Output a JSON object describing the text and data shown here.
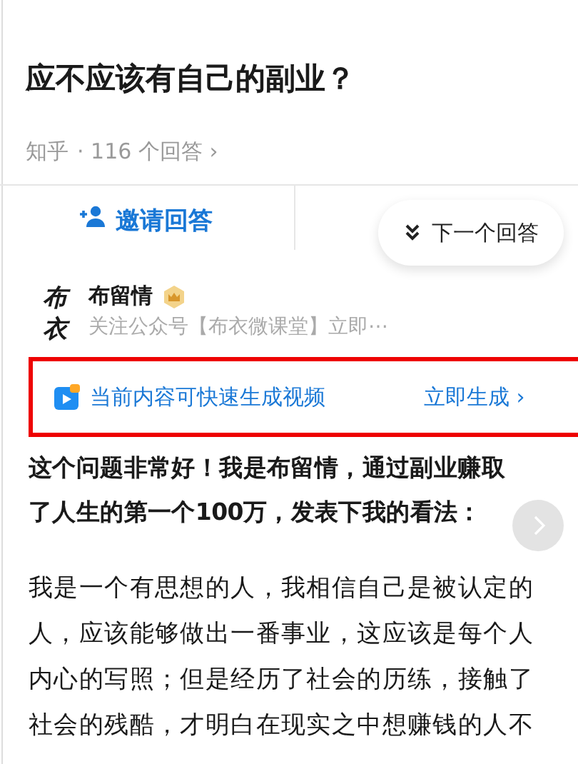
{
  "question": {
    "title": "应不应该有自己的副业？",
    "source": "知乎",
    "answer_count": "· 116 个回答",
    "chevron": "›"
  },
  "actions": {
    "invite": "邀请回答",
    "next": "下一个回答"
  },
  "author": {
    "name": "布留情",
    "logo": "布衣",
    "bio": "关注公众号【布衣微课堂】立即⋯"
  },
  "promo": {
    "text": "当前内容可快速生成视频",
    "action": "立即生成",
    "chevron": "›"
  },
  "answer": {
    "lead": "这个问题非常好！我是布留情，通过副业赚取了人生的第一个100万，发表下我的看法：",
    "body": "我是一个有思想的人，我相信自己是被认定的人，应该能够做出一番事业，这应该是每个人内心的写照；但是经历了社会的历练，接触了社会的残酷，才明白在现实之中想赚钱的人不"
  }
}
